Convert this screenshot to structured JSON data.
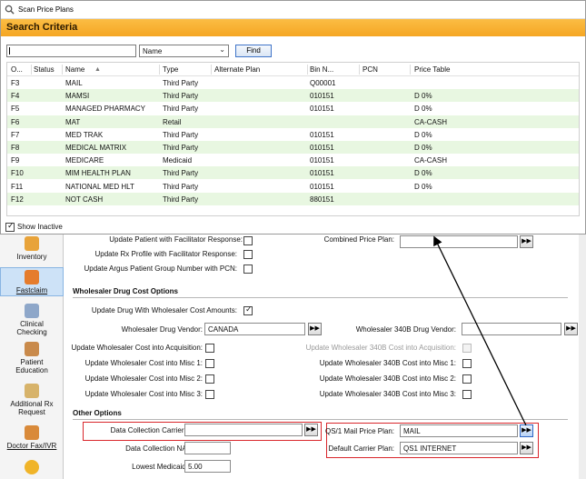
{
  "dialog": {
    "title": "Scan Price Plans",
    "criteria_title": "Search Criteria",
    "search_value": "",
    "field_selected": "Name",
    "find_label": "Find",
    "show_inactive_label": "Show Inactive",
    "show_inactive_checked": true,
    "columns": [
      "O...",
      "Status",
      "Name",
      "Type",
      "Alternate Plan",
      "Bin N...",
      "PCN",
      "Price Table"
    ],
    "rows": [
      {
        "id": "F3",
        "status": "",
        "name": "MAIL",
        "type": "Third Party",
        "alt": "",
        "bin": "Q00001",
        "pcn": "",
        "price_table": ""
      },
      {
        "id": "F4",
        "status": "",
        "name": "MAMSI",
        "type": "Third Party",
        "alt": "",
        "bin": "010151",
        "pcn": "",
        "price_table": "D 0%"
      },
      {
        "id": "F5",
        "status": "",
        "name": "MANAGED PHARMACY",
        "type": "Third Party",
        "alt": "",
        "bin": "010151",
        "pcn": "",
        "price_table": "D 0%"
      },
      {
        "id": "F6",
        "status": "",
        "name": "MAT",
        "type": "Retail",
        "alt": "",
        "bin": "",
        "pcn": "",
        "price_table": "CA-CASH"
      },
      {
        "id": "F7",
        "status": "",
        "name": "MED TRAK",
        "type": "Third Party",
        "alt": "",
        "bin": "010151",
        "pcn": "",
        "price_table": "D 0%"
      },
      {
        "id": "F8",
        "status": "",
        "name": "MEDICAL MATRIX",
        "type": "Third Party",
        "alt": "",
        "bin": "010151",
        "pcn": "",
        "price_table": "D 0%"
      },
      {
        "id": "F9",
        "status": "",
        "name": "MEDICARE",
        "type": "Medicaid",
        "alt": "",
        "bin": "010151",
        "pcn": "",
        "price_table": "CA-CASH"
      },
      {
        "id": "F10",
        "status": "",
        "name": "MIM HEALTH PLAN",
        "type": "Third Party",
        "alt": "",
        "bin": "010151",
        "pcn": "",
        "price_table": "D 0%"
      },
      {
        "id": "F11",
        "status": "",
        "name": "NATIONAL MED HLT",
        "type": "Third Party",
        "alt": "",
        "bin": "010151",
        "pcn": "",
        "price_table": "D 0%"
      },
      {
        "id": "F12",
        "status": "",
        "name": "NOT CASH",
        "type": "Third Party",
        "alt": "",
        "bin": "880151",
        "pcn": "",
        "price_table": ""
      }
    ]
  },
  "nav": {
    "items": [
      {
        "label": "Inventory",
        "icon": "inventory-icon"
      },
      {
        "label": "Fastclaim",
        "icon": "fastclaim-icon",
        "selected": true
      },
      {
        "label": "Clinical Checking",
        "icon": "clinical-checking-icon"
      },
      {
        "label": "Patient Education",
        "icon": "patient-education-icon"
      },
      {
        "label": "Additional Rx Request",
        "icon": "additional-rx-icon"
      },
      {
        "label": "Doctor Fax/IVR",
        "icon": "doctor-fax-icon"
      }
    ]
  },
  "form": {
    "update_patient_facilitator": "Update Patient with Facilitator Response:",
    "combined_price_plan": "Combined Price Plan:",
    "update_rx_profile": "Update Rx Profile with Facilitator Response:",
    "update_argus": "Update Argus Patient Group Number with PCN:",
    "wholesaler_section": "Wholesaler Drug Cost Options",
    "update_drug_wholesaler": "Update Drug With Wholesaler Cost Amounts:",
    "wholesaler_vendor_label": "Wholesaler Drug Vendor:",
    "wholesaler_vendor_value": "CANADA",
    "wholesaler_340b_vendor_label": "Wholesaler 340B Drug Vendor:",
    "wholesaler_340b_vendor_value": "",
    "update_cost_acq": "Update Wholesaler Cost into Acquisition:",
    "update_340b_acq": "Update Wholesaler 340B Cost into Acquisition:",
    "update_cost_misc1": "Update Wholesaler Cost into Misc 1:",
    "update_340b_misc1": "Update Wholesaler 340B Cost into Misc 1:",
    "update_cost_misc2": "Update Wholesaler Cost into Misc 2:",
    "update_340b_misc2": "Update Wholesaler 340B Cost into Misc 2:",
    "update_cost_misc3": "Update Wholesaler Cost into Misc 3:",
    "update_340b_misc3": "Update Wholesaler 340B Cost into Misc 3:",
    "other_section": "Other Options",
    "data_collection_carrier_label": "Data Collection Carrier Plan:",
    "data_collection_carrier_value": "",
    "qs1_mail_label": "QS/1 Mail Price Plan:",
    "qs1_mail_value": "MAIL",
    "data_collection_nabp_label": "Data Collection NABP#:",
    "data_collection_nabp_value": "",
    "default_carrier_label": "Default Carrier Plan:",
    "default_carrier_value": "QS1 INTERNET",
    "lowest_medicaid_label": "Lowest Medicaid Fee:",
    "lowest_medicaid_value": "5.00",
    "arrow_glyph": "▶▶"
  },
  "colors": {
    "criteria_bar": "#f5a623",
    "alt_row": "#e8f7e1",
    "highlight_box": "#d9262b"
  }
}
